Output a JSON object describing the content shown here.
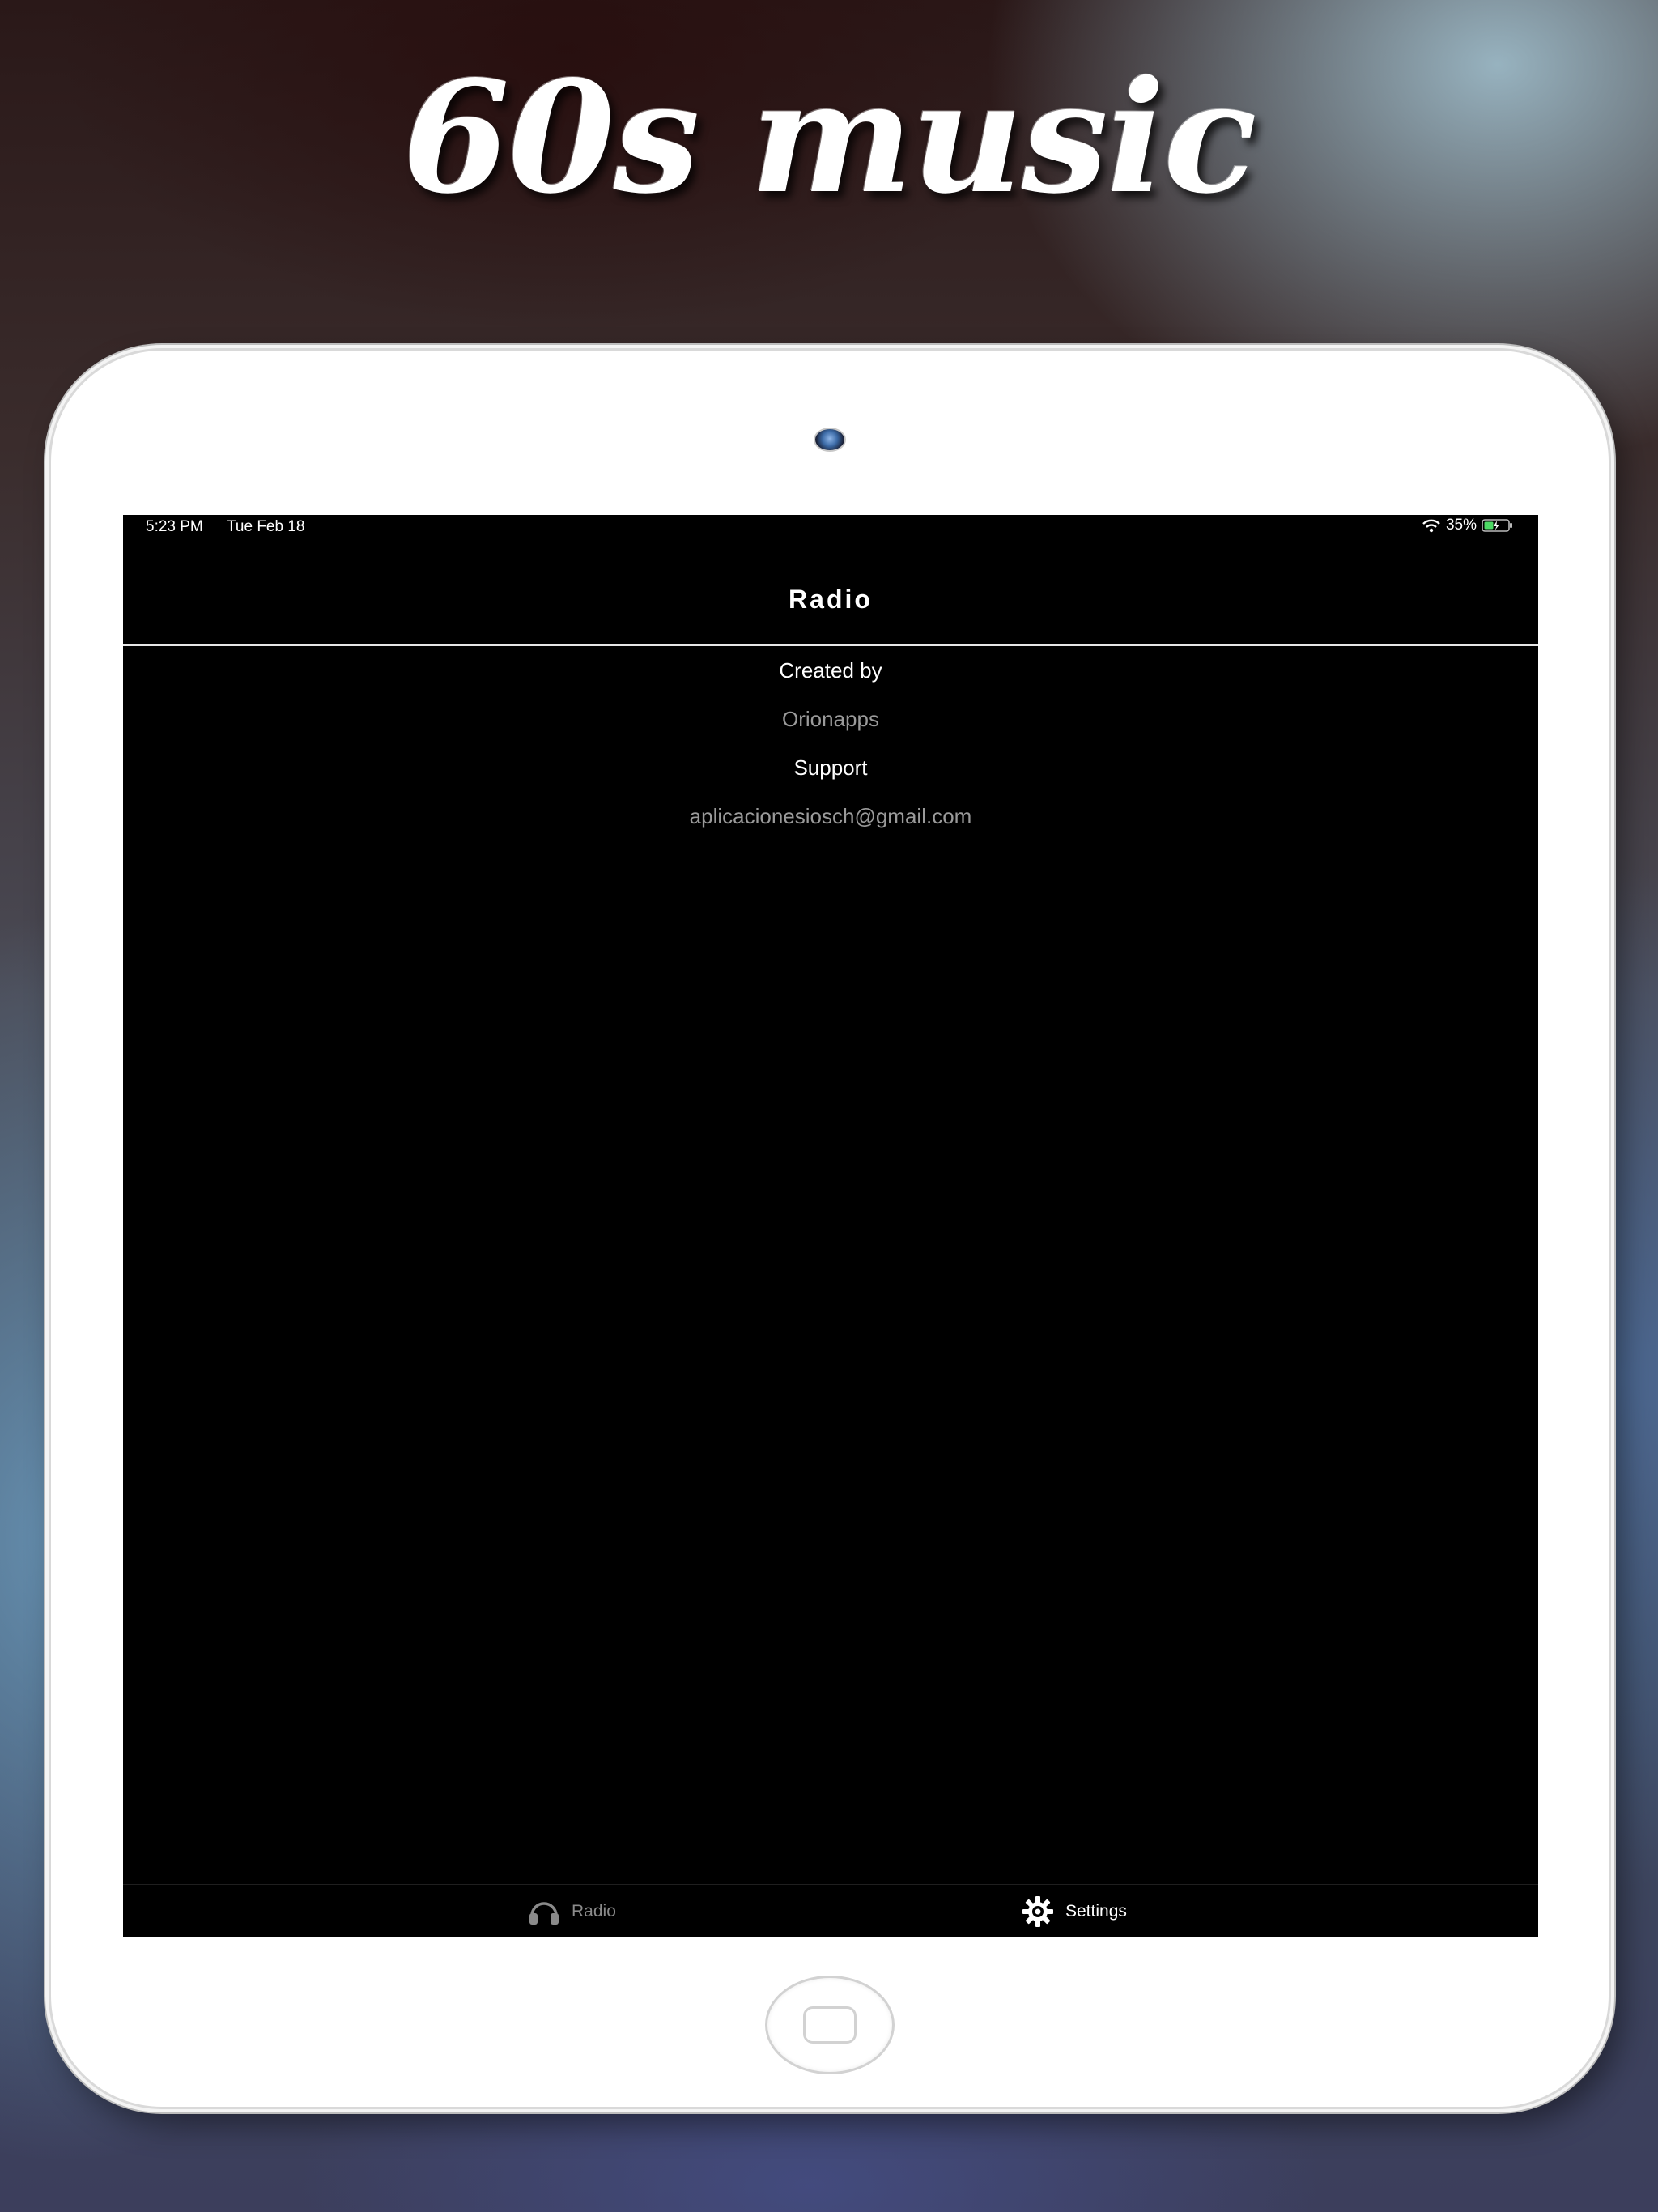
{
  "hero": {
    "title": "60s music"
  },
  "status_bar": {
    "time": "5:23 PM",
    "date": "Tue Feb 18",
    "battery": "35%"
  },
  "nav": {
    "title": "Radio"
  },
  "settings": [
    {
      "heading": "Created by",
      "value": "Orionapps"
    },
    {
      "heading": "Support",
      "value": "aplicacionesiosch@gmail.com"
    }
  ],
  "tabs": [
    {
      "label": "Radio",
      "icon": "headphones-icon",
      "selected": false
    },
    {
      "label": "Settings",
      "icon": "gear-icon",
      "selected": true
    }
  ],
  "colors": {
    "screen_bg": "#000000",
    "text_primary": "#ffffff",
    "text_secondary": "#9a9a9a",
    "tab_inactive": "#8a8a8a"
  }
}
